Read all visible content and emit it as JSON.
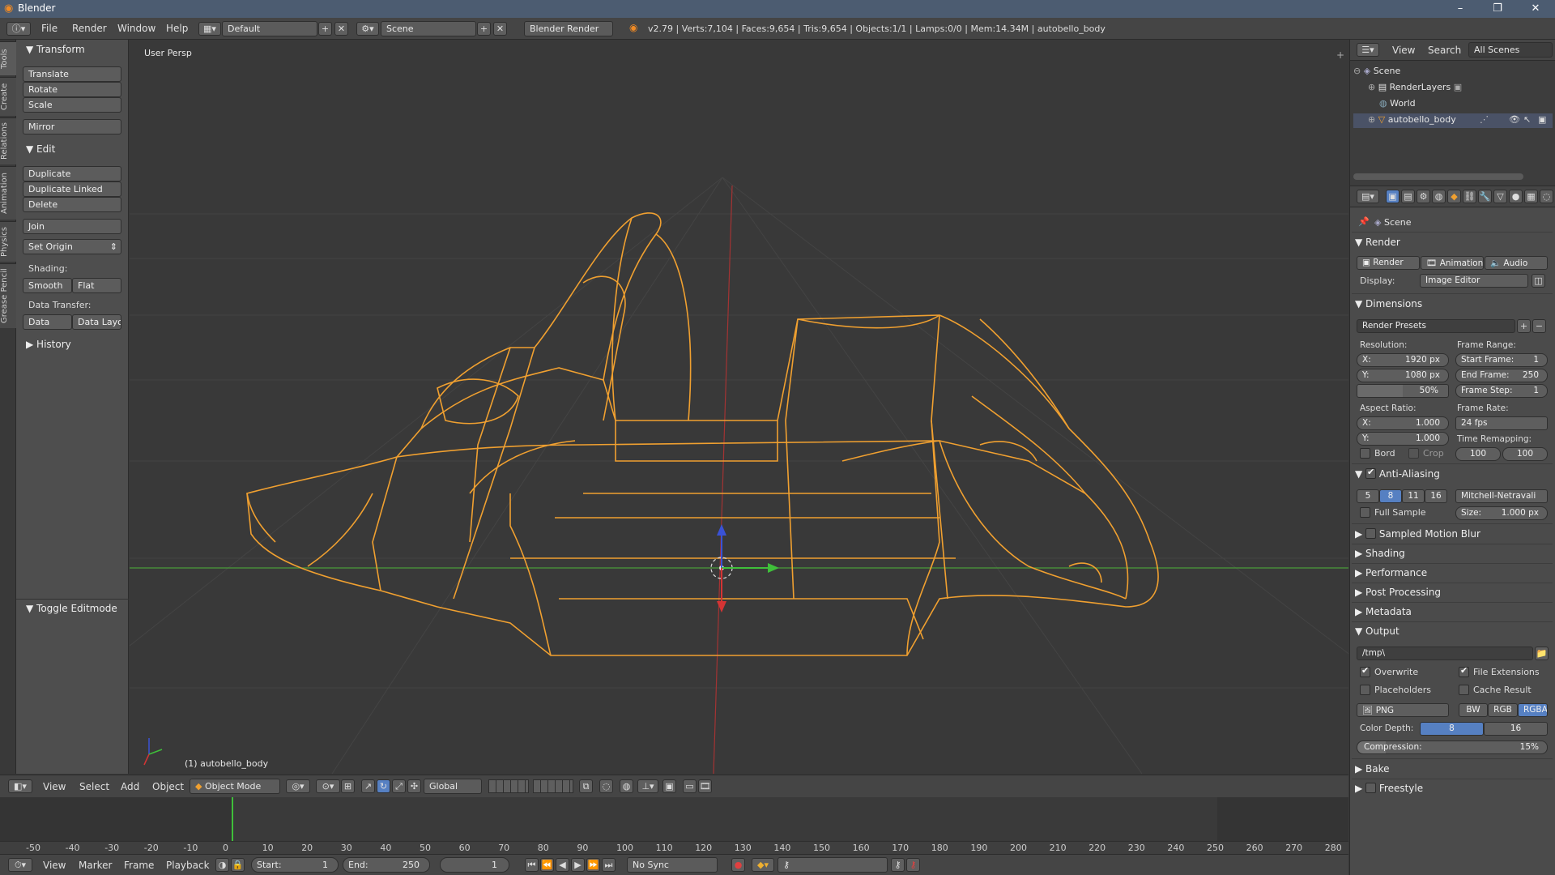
{
  "window": {
    "title": "Blender",
    "min": "–",
    "max": "❐",
    "close": "✕"
  },
  "menubar": {
    "items": [
      "File",
      "Render",
      "Window",
      "Help"
    ],
    "layout": "Default",
    "scene": "Scene",
    "engine": "Blender Render",
    "stats": "v2.79 | Verts:7,104 | Faces:9,654 | Tris:9,654 | Objects:1/1 | Lamps:0/0 | Mem:14.34M | autobello_body"
  },
  "left_tabs": [
    "Tools",
    "Create",
    "Relations",
    "Animation",
    "Physics",
    "Grease Pencil"
  ],
  "toolpanel": {
    "transform_header": "Transform",
    "translate": "Translate",
    "rotate": "Rotate",
    "scale": "Scale",
    "mirror": "Mirror",
    "edit_header": "Edit",
    "duplicate": "Duplicate",
    "duplicate_linked": "Duplicate Linked",
    "delete": "Delete",
    "join": "Join",
    "set_origin": "Set Origin",
    "shading_label": "Shading:",
    "smooth": "Smooth",
    "flat": "Flat",
    "data_transfer_label": "Data Transfer:",
    "data": "Data",
    "data_layo": "Data Layo",
    "history_header": "History",
    "toggle_editmode": "Toggle Editmode"
  },
  "viewport": {
    "view_label": "User Persp",
    "object_label": "(1) autobello_body"
  },
  "header3d": {
    "view": "View",
    "select": "Select",
    "add": "Add",
    "object": "Object",
    "mode": "Object Mode",
    "orientation": "Global"
  },
  "timeline": {
    "ticks": [
      "-50",
      "-40",
      "-30",
      "-20",
      "-10",
      "0",
      "10",
      "20",
      "30",
      "40",
      "50",
      "60",
      "70",
      "80",
      "90",
      "100",
      "110",
      "120",
      "130",
      "140",
      "150",
      "160",
      "170",
      "180",
      "190",
      "200",
      "210",
      "220",
      "230",
      "240",
      "250",
      "260",
      "270",
      "280"
    ],
    "current_frame": "1",
    "start_label": "Start:",
    "start": "1",
    "end_label": "End:",
    "end": "250",
    "menus": [
      "View",
      "Marker",
      "Frame",
      "Playback"
    ],
    "sync": "No Sync"
  },
  "outliner": {
    "view": "View",
    "search": "Search",
    "all_scenes": "All Scenes",
    "scene": "Scene",
    "renderlayers": "RenderLayers",
    "world": "World",
    "object": "autobello_body"
  },
  "properties": {
    "context": "Scene",
    "render_header": "Render",
    "render_btn": "Render",
    "animation_btn": "Animation",
    "audio_btn": "Audio",
    "display_label": "Display:",
    "display_value": "Image Editor",
    "dimensions_header": "Dimensions",
    "render_presets": "Render Presets",
    "resolution_label": "Resolution:",
    "res_x_label": "X:",
    "res_x": "1920 px",
    "res_y_label": "Y:",
    "res_y": "1080 px",
    "res_pct": "50%",
    "frame_range_label": "Frame Range:",
    "start_frame_label": "Start Frame:",
    "start_frame": "1",
    "end_frame_label": "End Frame:",
    "end_frame": "250",
    "frame_step_label": "Frame Step:",
    "frame_step": "1",
    "aspect_label": "Aspect Ratio:",
    "asp_x_label": "X:",
    "asp_x": "1.000",
    "asp_y_label": "Y:",
    "asp_y": "1.000",
    "frame_rate_label": "Frame Rate:",
    "frame_rate": "24 fps",
    "time_remap_label": "Time Remapping:",
    "remap_old": "100",
    "remap_new": "100",
    "bord": "Bord",
    "crop": "Crop",
    "aa_header": "Anti-Aliasing",
    "aa_samples": [
      "5",
      "8",
      "11",
      "16"
    ],
    "aa_filter": "Mitchell-Netravali",
    "full_sample": "Full Sample",
    "size_label": "Size:",
    "size": "1.000 px",
    "motion_blur": "Sampled Motion Blur",
    "shading": "Shading",
    "performance": "Performance",
    "post_processing": "Post Processing",
    "metadata": "Metadata",
    "output_header": "Output",
    "output_path": "/tmp\\",
    "overwrite": "Overwrite",
    "file_extensions": "File Extensions",
    "placeholders": "Placeholders",
    "cache_result": "Cache Result",
    "format": "PNG",
    "bw": "BW",
    "rgb": "RGB",
    "rgba": "RGBA",
    "color_depth_label": "Color Depth:",
    "depth_8": "8",
    "depth_16": "16",
    "compression_label": "Compression:",
    "compression": "15%",
    "bake": "Bake",
    "freestyle": "Freestyle"
  },
  "colors": {
    "wire": "#f0a030",
    "accent_blue": "#5680c2",
    "x_axis": "#b23333",
    "y_axis": "#4aa33a"
  }
}
